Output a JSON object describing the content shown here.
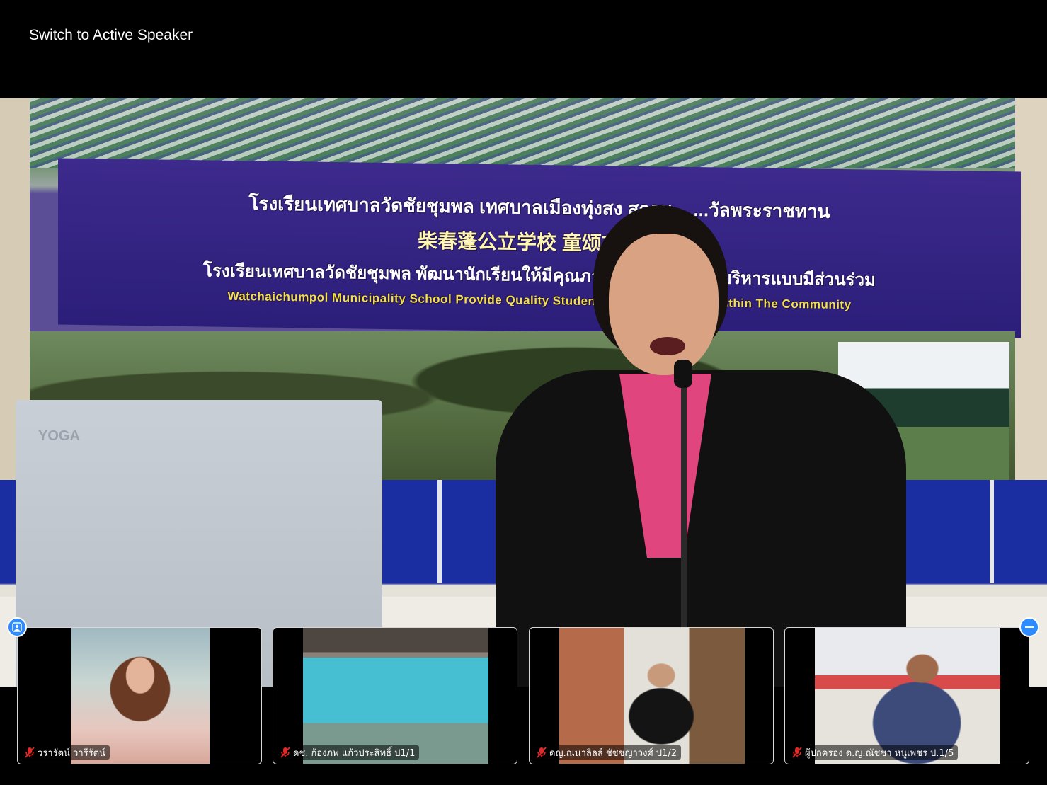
{
  "top_bar": {
    "switch_label": "Switch to Active Speaker"
  },
  "main_video": {
    "banner": {
      "line1": "โรงเรียนเทศบาลวัดชัยชุมพล  เทศบาลเมืองทุ่งสง  สถาน...  ...วัลพระราชทาน",
      "line2": "柴春蓬公立学校 童颂市政府",
      "line3": "โรงเรียนเทศบาลวัดชัยชุมพล  พัฒนานักเรียนให้มีคุณภาพ  สู่มาต...  ...การบริหารแบบมีส่วนร่วม",
      "line4": "Watchaichumpol Municipality School Provide Quality Students To Worl...  ...hool Within The Community"
    },
    "laptop_brand": "YOGA"
  },
  "participants": [
    {
      "name": "วรารัตน์ วารีรัตน์",
      "muted": true
    },
    {
      "name": "ดช. ก้องภพ แก้วประสิทธิ์ ป1/1",
      "muted": true
    },
    {
      "name": "ดญ.ณนาลิลล์ ชัชชญาวงศ์ ป1/2",
      "muted": true
    },
    {
      "name": "ผู้ปกครอง ด.ญ.ณัชชา หนูเพชร ป.1/5",
      "muted": true
    }
  ],
  "icons": {
    "avatar_toggle": "person-icon",
    "collapse": "minus-icon",
    "mute": "muted-mic-icon"
  },
  "colors": {
    "accent": "#2d8cff",
    "mute_red": "#e02828",
    "background": "#000000"
  }
}
